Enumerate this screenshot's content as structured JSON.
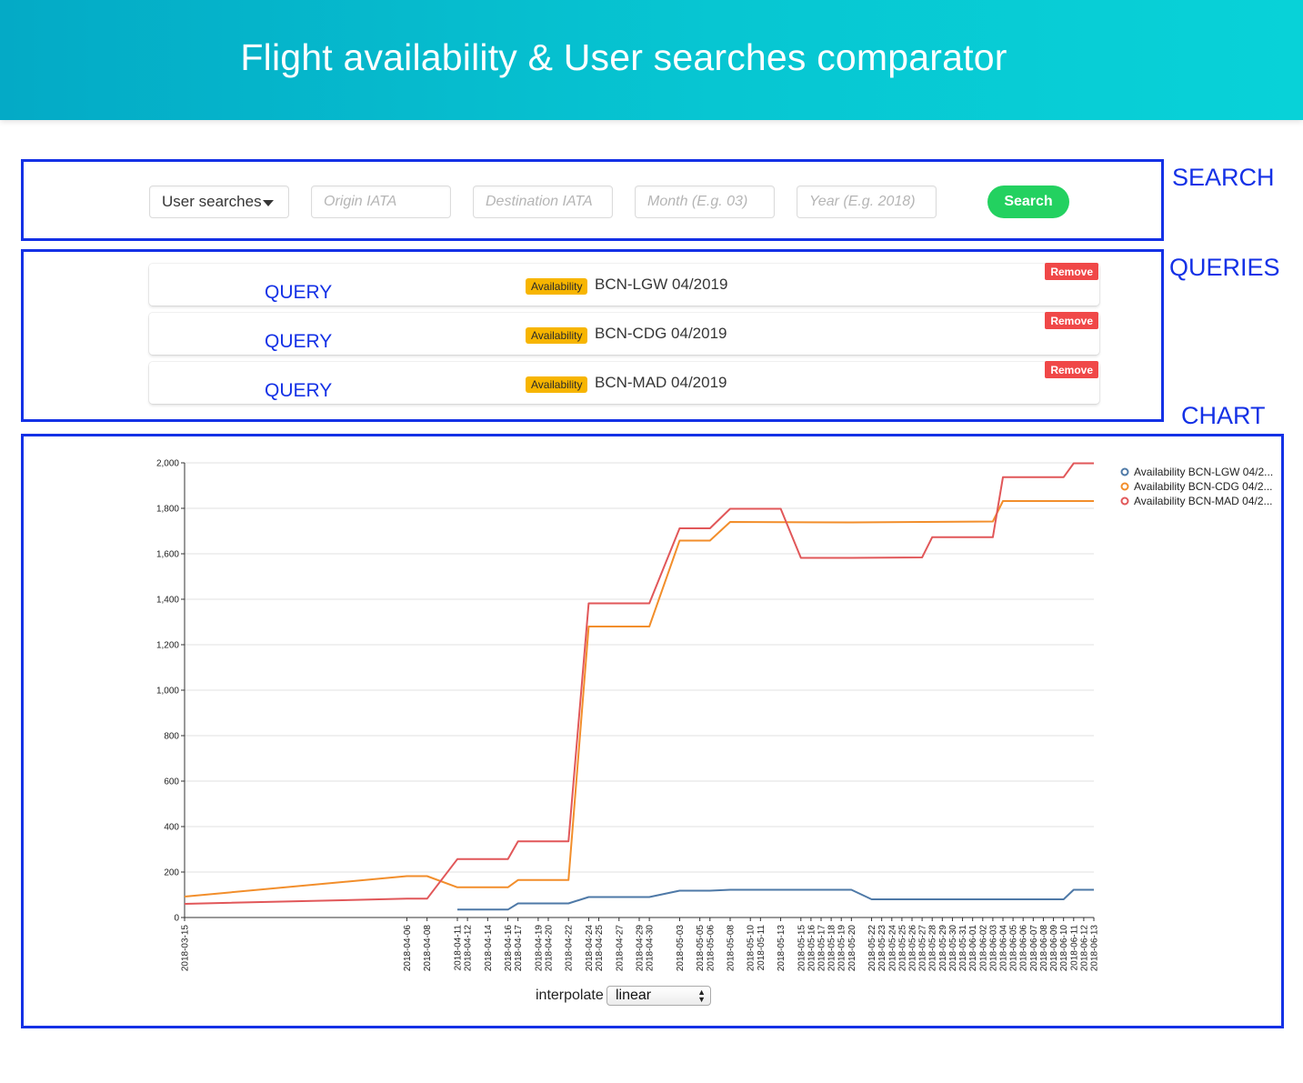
{
  "header": {
    "title": "Flight availability & User searches comparator"
  },
  "frames": {
    "search": "SEARCH",
    "queries": "QUERIES",
    "chart": "CHART"
  },
  "search": {
    "mode_selected": "User searches",
    "origin_placeholder": "Origin IATA",
    "destination_placeholder": "Destination IATA",
    "month_placeholder": "Month (E.g. 03)",
    "year_placeholder": "Year (E.g. 2018)",
    "button_label": "Search"
  },
  "queries": [
    {
      "label": "QUERY",
      "tag": "Availability",
      "route": "BCN-LGW 04/2019",
      "remove": "Remove"
    },
    {
      "label": "QUERY",
      "tag": "Availability",
      "route": "BCN-CDG 04/2019",
      "remove": "Remove"
    },
    {
      "label": "QUERY",
      "tag": "Availability",
      "route": "BCN-MAD 04/2019",
      "remove": "Remove"
    }
  ],
  "colors": {
    "accent": "#1431e6",
    "search_button": "#23d160",
    "tag": "#f7b500",
    "remove": "#f04848"
  },
  "chart_data": {
    "type": "line",
    "title": "",
    "xlabel": "",
    "ylabel": "",
    "ylim": [
      0,
      2000
    ],
    "yticks": [
      0,
      200,
      400,
      600,
      800,
      1000,
      1200,
      1400,
      1600,
      1800,
      2000
    ],
    "ytick_labels": [
      "0",
      "200",
      "400",
      "600",
      "800",
      "1,000",
      "1,200",
      "1,400",
      "1,600",
      "1,800",
      "2,000"
    ],
    "x_tick_dates": [
      "2018-03-15",
      "2018-04-06",
      "2018-04-08",
      "2018-04-11",
      "2018-04-12",
      "2018-04-14",
      "2018-04-16",
      "2018-04-17",
      "2018-04-19",
      "2018-04-20",
      "2018-04-22",
      "2018-04-24",
      "2018-04-25",
      "2018-04-27",
      "2018-04-29",
      "2018-04-30",
      "2018-05-03",
      "2018-05-05",
      "2018-05-06",
      "2018-05-08",
      "2018-05-10",
      "2018-05-11",
      "2018-05-13",
      "2018-05-15",
      "2018-05-16",
      "2018-05-17",
      "2018-05-18",
      "2018-05-19",
      "2018-05-20",
      "2018-05-22",
      "2018-05-23",
      "2018-05-24",
      "2018-05-25",
      "2018-05-26",
      "2018-05-27",
      "2018-05-28",
      "2018-05-29",
      "2018-05-30",
      "2018-05-31",
      "2018-06-01",
      "2018-06-02",
      "2018-06-03",
      "2018-06-04",
      "2018-06-05",
      "2018-06-06",
      "2018-06-07",
      "2018-06-08",
      "2018-06-09",
      "2018-06-10",
      "2018-06-11",
      "2018-06-12",
      "2018-06-13"
    ],
    "grid": true,
    "legend_position": "top-right",
    "series": [
      {
        "name": "Availability BCN-LGW 04/2...",
        "color": "#4e79a7",
        "points": [
          [
            "2018-04-11",
            35
          ],
          [
            "2018-04-16",
            35
          ],
          [
            "2018-04-17",
            62
          ],
          [
            "2018-04-22",
            62
          ],
          [
            "2018-04-24",
            90
          ],
          [
            "2018-04-30",
            90
          ],
          [
            "2018-05-03",
            118
          ],
          [
            "2018-05-06",
            118
          ],
          [
            "2018-05-08",
            122
          ],
          [
            "2018-05-20",
            122
          ],
          [
            "2018-05-22",
            80
          ],
          [
            "2018-06-10",
            80
          ],
          [
            "2018-06-11",
            122
          ],
          [
            "2018-06-13",
            122
          ]
        ]
      },
      {
        "name": "Availability BCN-CDG 04/2...",
        "color": "#f28e2b",
        "points": [
          [
            "2018-03-15",
            92
          ],
          [
            "2018-04-06",
            182
          ],
          [
            "2018-04-08",
            182
          ],
          [
            "2018-04-11",
            133
          ],
          [
            "2018-04-16",
            133
          ],
          [
            "2018-04-17",
            165
          ],
          [
            "2018-04-22",
            165
          ],
          [
            "2018-04-24",
            1280
          ],
          [
            "2018-04-30",
            1280
          ],
          [
            "2018-05-03",
            1658
          ],
          [
            "2018-05-06",
            1658
          ],
          [
            "2018-05-08",
            1740
          ],
          [
            "2018-05-20",
            1738
          ],
          [
            "2018-05-27",
            1740
          ],
          [
            "2018-06-03",
            1742
          ],
          [
            "2018-06-04",
            1832
          ],
          [
            "2018-06-13",
            1832
          ]
        ]
      },
      {
        "name": "Availability BCN-MAD 04/2...",
        "color": "#e15759",
        "points": [
          [
            "2018-03-15",
            60
          ],
          [
            "2018-04-06",
            83
          ],
          [
            "2018-04-08",
            83
          ],
          [
            "2018-04-11",
            257
          ],
          [
            "2018-04-16",
            257
          ],
          [
            "2018-04-17",
            335
          ],
          [
            "2018-04-22",
            335
          ],
          [
            "2018-04-24",
            1382
          ],
          [
            "2018-04-30",
            1382
          ],
          [
            "2018-05-03",
            1712
          ],
          [
            "2018-05-06",
            1712
          ],
          [
            "2018-05-08",
            1798
          ],
          [
            "2018-05-13",
            1798
          ],
          [
            "2018-05-15",
            1582
          ],
          [
            "2018-05-20",
            1582
          ],
          [
            "2018-05-27",
            1584
          ],
          [
            "2018-05-28",
            1673
          ],
          [
            "2018-06-03",
            1673
          ],
          [
            "2018-06-04",
            1937
          ],
          [
            "2018-06-10",
            1937
          ],
          [
            "2018-06-11",
            1998
          ],
          [
            "2018-06-13",
            1998
          ]
        ]
      }
    ]
  },
  "controls": {
    "interpolate_label": "interpolate",
    "interpolate_value": "linear"
  }
}
